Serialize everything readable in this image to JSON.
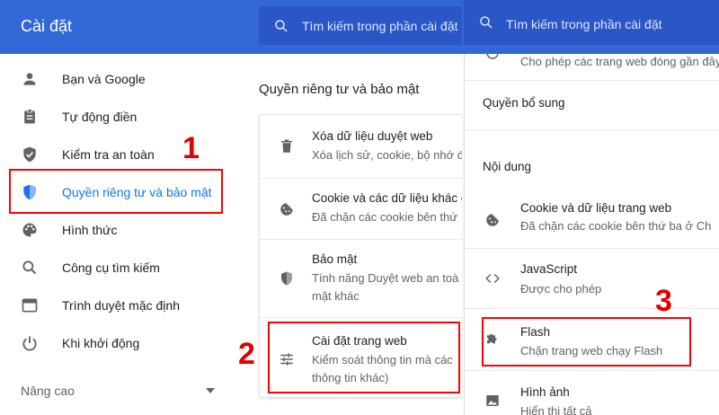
{
  "header": {
    "title": "Cài đặt",
    "search_placeholder": "Tìm kiếm trong phần cài đặt"
  },
  "sidebar": {
    "items": [
      {
        "label": "Bạn và Google",
        "icon": "person-icon"
      },
      {
        "label": "Tự động điền",
        "icon": "clipboard-icon"
      },
      {
        "label": "Kiểm tra an toàn",
        "icon": "shield-check-icon"
      },
      {
        "label": "Quyền riêng tư và bảo mật",
        "icon": "shield-icon"
      },
      {
        "label": "Hình thức",
        "icon": "palette-icon"
      },
      {
        "label": "Công cụ tìm kiếm",
        "icon": "search-icon"
      },
      {
        "label": "Trình duyệt mặc định",
        "icon": "browser-icon"
      },
      {
        "label": "Khi khởi động",
        "icon": "power-icon"
      }
    ],
    "advanced_label": "Nâng cao"
  },
  "middle": {
    "title": "Quyền riêng tư và bảo mật",
    "rows": [
      {
        "title": "Xóa dữ liệu duyệt web",
        "desc": "Xóa lịch sử, cookie, bộ nhớ đ",
        "icon": "trash-icon"
      },
      {
        "title": "Cookie và các dữ liệu khác c",
        "desc": "Đã chặn các cookie bên thứ",
        "icon": "cookie-icon"
      },
      {
        "title": "Bảo mật",
        "desc": "Tính năng Duyệt web an toà",
        "desc2": "mật khác",
        "icon": "shield-icon"
      },
      {
        "title": "Cài đặt trang web",
        "desc": "Kiểm soát thông tin mà các",
        "desc2": "thông tin khác)",
        "icon": "tune-icon"
      }
    ]
  },
  "right": {
    "top_row_desc": "Cho phép các trang web đóng gần đây",
    "section_additional": "Quyền bổ sung",
    "section_content": "Nội dung",
    "rows": [
      {
        "title": "Cookie và dữ liệu trang web",
        "desc": "Đã chặn các cookie bên thứ ba ở Ch",
        "icon": "cookie-icon"
      },
      {
        "title": "JavaScript",
        "desc": "Được cho phép",
        "icon": "code-icon"
      },
      {
        "title": "Flash",
        "desc": "Chặn trang web chạy Flash",
        "icon": "puzzle-icon"
      },
      {
        "title": "Hình ảnh",
        "desc": "Hiển thị tất cả",
        "icon": "image-icon"
      }
    ]
  },
  "annotations": [
    "1",
    "2",
    "3"
  ],
  "colors": {
    "header": "#3367d6",
    "search_bg": "#2a56c6",
    "accent": "#1a73e8",
    "annotation_red": "#ff0000"
  }
}
